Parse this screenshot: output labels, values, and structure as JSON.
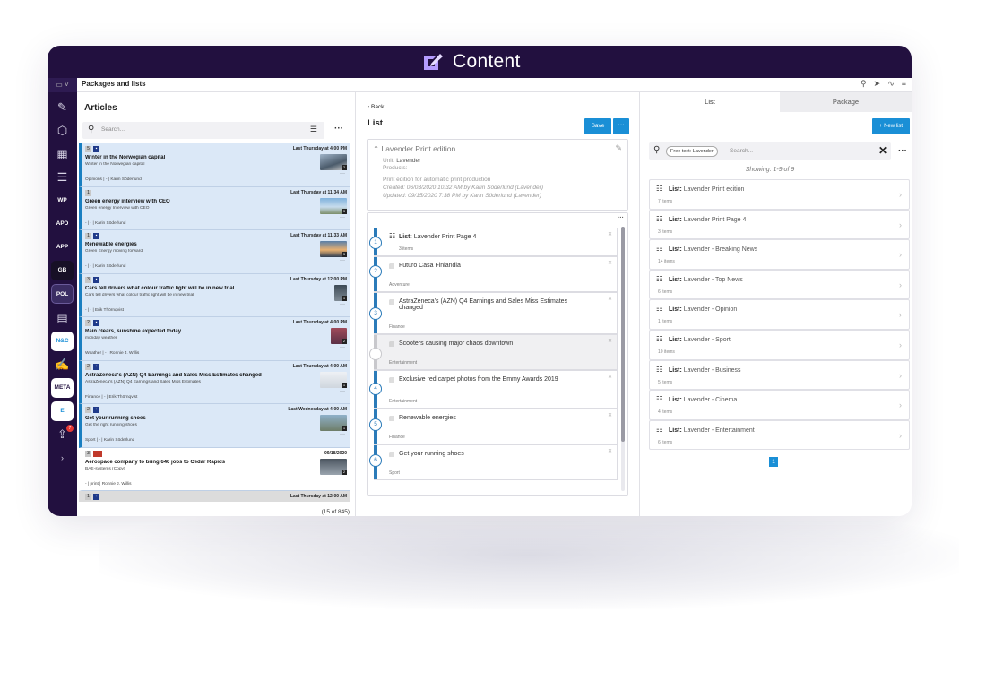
{
  "app": {
    "title": "Content",
    "breadcrumb": "Packages and lists"
  },
  "colors": {
    "brand_dark": "#22103f",
    "accent_blue": "#1a8fd6",
    "highlight_row": "#dbe8f7"
  },
  "rail": {
    "items": [
      "WP",
      "APD",
      "APP",
      "GB",
      "POL",
      "N&C",
      "META",
      "E"
    ],
    "badge": "7"
  },
  "articles": {
    "title": "Articles",
    "search_placeholder": "Search...",
    "count": "(15 of 845)",
    "items": [
      {
        "n": "5",
        "time": "Last Thursday at 4:00 PM",
        "title": "Winter in the Norwegian capital",
        "sub": "Winter in the Norwegian capital",
        "meta": "Opinions | - | Karin Söderlund",
        "thumb": "2"
      },
      {
        "n": "1",
        "time": "Last Thursday at 11:34 AM",
        "title": "Green energy interview with CEO",
        "sub": "Green energy Interview with CEO",
        "meta": "- | - | Karin Söderlund",
        "thumb": "3"
      },
      {
        "n": "1",
        "time": "Last Thursday at 11:33 AM",
        "title": "Renewable energies",
        "sub": "Green Energy moving forward",
        "meta": "- | - | Karin Söderlund",
        "thumb": "3"
      },
      {
        "n": "3",
        "time": "Last Thursday at 12:00 PM",
        "title": "Cars tell drivers what colour traffic light will be in new trial",
        "sub": "Cars tell drivers what colour traffic light will be in new trial",
        "meta": "- | - | Erik Thörnqvist",
        "thumb": "1"
      },
      {
        "n": "2",
        "time": "Last Thursday at 4:00 PM",
        "title": "Rain clears, sunshine expected today",
        "sub": "monday weather",
        "meta": "Weather | - | Ronnie J. Willis",
        "thumb": "2"
      },
      {
        "n": "2",
        "time": "Last Thursday at 4:00 AM",
        "title": "AstraZeneca's (AZN) Q4 Earnings and Sales Miss Estimates changed",
        "sub": "AstraZeneca's (AZN) Q4 Earnings and Sales Miss Estimates",
        "meta": "Finance | - | Erik Thörnqvist",
        "thumb": "1"
      },
      {
        "n": "2",
        "time": "Last Wednesday at 4:00 AM",
        "title": "Get your running shoes",
        "sub": "Get the right running shoes",
        "meta": "Sport | - | Karin Söderlund",
        "thumb": "1"
      },
      {
        "n": "3",
        "time": "09/18/2020",
        "title": "Aerospace company to bring 640 jobs to Cedar Rapids",
        "sub": "BAE-systems (Copy)",
        "meta": "- | print | Ronnie J. Willis",
        "thumb": "2"
      },
      {
        "n": "1",
        "time": "Last Thursday at 12:00 AM",
        "title": "",
        "sub": "",
        "meta": "",
        "thumb": ""
      }
    ]
  },
  "editor": {
    "back": "Back",
    "title": "List",
    "save": "Save",
    "list_name": "Lavender Print edition",
    "unit_label": "Unit:",
    "unit_value": "Lavender",
    "products_label": "Products:",
    "description": "Print edition for automatic print production",
    "created": "Created: 06/03/2020 10:32 AM by Karin Söderlund (Lavender)",
    "updated": "Updated: 09/15/2020 7:38 PM by Karin Söderlund (Lavender)",
    "items": [
      {
        "num": "1",
        "prefix": "List:",
        "title": "Lavender Print Page 4",
        "sub": "3 items",
        "kind": "list"
      },
      {
        "num": "2",
        "prefix": "",
        "title": "Futuro Casa Finlandia",
        "sub": "Adventure",
        "kind": "article"
      },
      {
        "num": "3",
        "prefix": "",
        "title": "AstraZeneca's (AZN) Q4 Earnings and Sales Miss Estimates changed",
        "sub": "Finance",
        "kind": "article"
      },
      {
        "num": "",
        "prefix": "",
        "title": "Scooters causing major chaos downtown",
        "sub": "Entertainment",
        "kind": "article"
      },
      {
        "num": "4",
        "prefix": "",
        "title": "Exclusive red carpet photos from the Emmy Awards 2019",
        "sub": "Entertainment",
        "kind": "article"
      },
      {
        "num": "5",
        "prefix": "",
        "title": "Renewable energies",
        "sub": "Finance",
        "kind": "article"
      },
      {
        "num": "6",
        "prefix": "",
        "title": "Get your running shoes",
        "sub": "Sport",
        "kind": "article"
      }
    ]
  },
  "right": {
    "tabs": [
      "List",
      "Package"
    ],
    "new_list": "+ New list",
    "chip": "Free text: Lavender",
    "search_placeholder": "Search...",
    "showing": "Showing: 1-9 of 9",
    "page": "1",
    "lists": [
      {
        "title": "Lavender Print ecition",
        "sub": "7 items"
      },
      {
        "title": "Lavender Print Page 4",
        "sub": "3 items"
      },
      {
        "title": "Lavender - Breaking News",
        "sub": "14 items"
      },
      {
        "title": "Lavender - Top News",
        "sub": "6 items"
      },
      {
        "title": "Lavender - Opinion",
        "sub": "1 items"
      },
      {
        "title": "Lavender - Sport",
        "sub": "10 items"
      },
      {
        "title": "Lavender - Business",
        "sub": "5 items"
      },
      {
        "title": "Lavender - Cinema",
        "sub": "4 items"
      },
      {
        "title": "Lavender - Entertainment",
        "sub": "6 items"
      }
    ],
    "list_prefix": "List:"
  }
}
